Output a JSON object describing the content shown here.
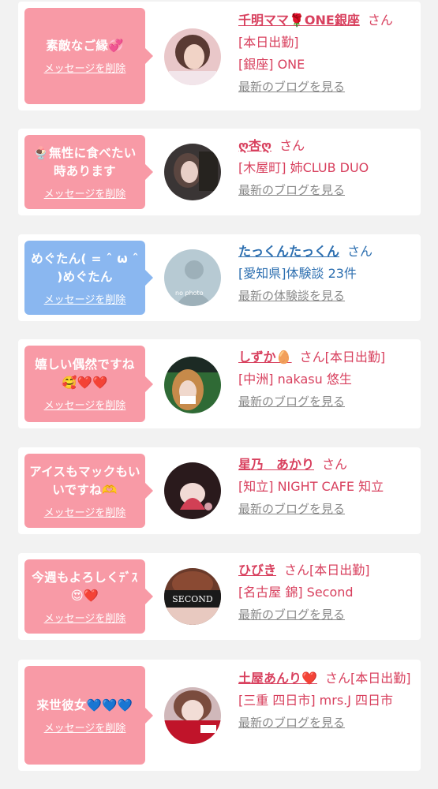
{
  "delete_label": "メッセージを削除",
  "san": "さん",
  "cards": [
    {
      "message": "素敵なご縁💞",
      "name": "千明ママ🌹ONE銀座",
      "status": "[本日出勤]",
      "workplace": "[銀座] ONE",
      "link": "最新のブログを見る",
      "bubble_color": "#f89aa6",
      "avatar": "photo"
    },
    {
      "message": "🍨無性に食べたい時あります",
      "name": "ღ杏ღ",
      "status": "",
      "workplace": "[木屋町] 姉CLUB DUO",
      "link": "最新のブログを見る",
      "bubble_color": "#f89aa6",
      "avatar": "photo"
    },
    {
      "message": "めぐたん( = ˆ ω ˆ )めぐたん",
      "name": "たっくんたっくん",
      "status": "",
      "workplace": "[愛知県]体験談 23件",
      "link": "最新の体験談を見る",
      "bubble_color": "#8ab7f0",
      "avatar": "no photo"
    },
    {
      "message": "嬉しい偶然ですね🥰❤️❤️",
      "name": "しずか🥚",
      "status": "[本日出勤]",
      "workplace": "[中洲] nakasu 悠生",
      "link": "最新のブログを見る",
      "bubble_color": "#f89aa6",
      "avatar": "photo"
    },
    {
      "message": "アイスもマックもいいですね🫶",
      "name": "星乃　あかり",
      "status": "",
      "workplace": "[知立] NIGHT CAFE 知立",
      "link": "最新のブログを見る",
      "bubble_color": "#f89aa6",
      "avatar": "photo"
    },
    {
      "message": "今週もよろしくﾃﾞｽ😍❤️",
      "name": "ひびき",
      "status": "[本日出勤]",
      "workplace": "[名古屋 錦] Second",
      "link": "最新のブログを見る",
      "bubble_color": "#f89aa6",
      "avatar": "SECOND"
    },
    {
      "message": "来世彼女💙💙💙",
      "name": "土屋あんり❤️",
      "status": "[本日出勤]",
      "workplace": "[三重 四日市] mrs.J 四日市",
      "link": "最新のブログを見る",
      "bubble_color": "#f89aa6",
      "avatar": "photo"
    }
  ]
}
